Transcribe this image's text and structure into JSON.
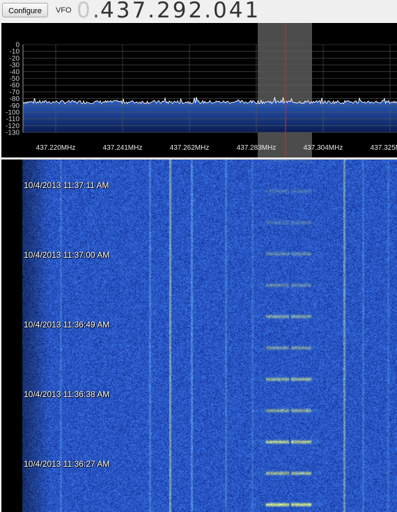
{
  "toolbar": {
    "configure_label": "Configure",
    "vfo_label": "VFO",
    "vfo_leading": "0",
    "vfo_separator": ".",
    "vfo_value": "437.292.041"
  },
  "spectrum": {
    "db_ticks": [
      "0",
      "-10",
      "-20",
      "-30",
      "-40",
      "-50",
      "-60",
      "-70",
      "-80",
      "-90",
      "-100",
      "-110",
      "-120",
      "-130"
    ],
    "freq_labels": [
      "437.220MHz",
      "437.241MHz",
      "437.262MHz",
      "437.283MHz",
      "437.304MHz",
      "437.325MHz"
    ],
    "noise_floor_db": -85,
    "colors": {
      "background": "#000000",
      "grid": "#5a5a5a",
      "trace": "#ffffff",
      "fill": "#1f4fa8",
      "center_line": "#e02020",
      "passband": "#8a8a8a"
    }
  },
  "waterfall": {
    "timestamps": [
      "10/4/2013 11:37:11 AM",
      "10/4/2013 11:37:00 AM",
      "10/4/2013 11:36:49 AM",
      "10/4/2013 11:36:38 AM",
      "10/4/2013 11:36:27 AM"
    ],
    "colors": {
      "background": "#1e3fb4",
      "noise_light": "#3a66e0",
      "signal": "#f2e24a",
      "signal_edge": "#7fd8c8"
    }
  }
}
